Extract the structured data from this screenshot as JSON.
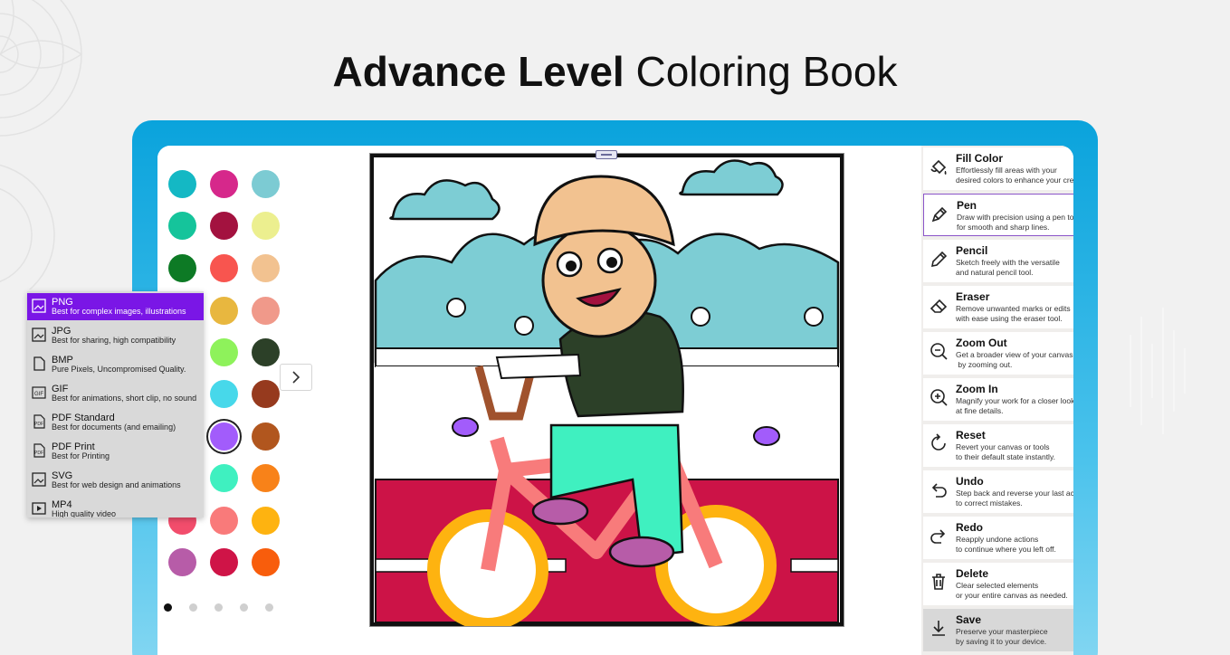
{
  "headline": {
    "bold": "Advance Level",
    "regular": "Coloring Book"
  },
  "palette": {
    "colors": [
      "#14b8c4",
      "#d6288b",
      "#7ccbd3",
      "#15c49b",
      "#a3123f",
      "#ecef8f",
      "#0d7a25",
      "#f8554f",
      "#f2c290",
      "#2e9fc8",
      "#e8b73f",
      "#f0998a",
      "#6fc63a",
      "#8ef25b",
      "#2c4028",
      "#1d6bb5",
      "#47d8ea",
      "#963a1e",
      "#b276d4",
      "#a25cfb",
      "#b1561e",
      "#ff4f88",
      "#3ff0c0",
      "#f88219",
      "#f24d6c",
      "#f97a7a",
      "#feb310",
      "#b75ca8",
      "#cf1447",
      "#f85d0c"
    ],
    "selected_color": "#a25cfb",
    "page_count": 5,
    "active_page": 1
  },
  "tools": [
    {
      "name": "Fill Color",
      "desc": "Effortlessly fill areas with your\ndesired colors to enhance your creations.",
      "icon": "fill-color-icon"
    },
    {
      "name": "Pen",
      "desc": "Draw with precision using a pen tool\nfor smooth and sharp lines.",
      "icon": "pen-icon",
      "active": true
    },
    {
      "name": "Pencil",
      "desc": "Sketch freely with the versatile\nand natural pencil tool.",
      "icon": "pencil-icon"
    },
    {
      "name": "Eraser",
      "desc": "Remove unwanted marks or edits\nwith ease using the eraser tool.",
      "icon": "eraser-icon"
    },
    {
      "name": "Zoom Out",
      "desc": "Get a broader view of your canvas\n by zooming out.",
      "icon": "zoom-out-icon"
    },
    {
      "name": "Zoom In",
      "desc": "Magnify your work for a closer look\nat fine details.",
      "icon": "zoom-in-icon"
    },
    {
      "name": "Reset",
      "desc": "Revert your canvas or tools\nto their default state instantly.",
      "icon": "reset-icon"
    },
    {
      "name": "Undo",
      "desc": "Step back and reverse your last action\nto correct mistakes.",
      "icon": "undo-icon"
    },
    {
      "name": "Redo",
      "desc": "Reapply undone actions\nto continue where you left off.",
      "icon": "redo-icon"
    },
    {
      "name": "Delete",
      "desc": "Clear selected elements\nor your entire canvas as needed.",
      "icon": "trash-icon"
    },
    {
      "name": "Save",
      "desc": "Preserve your masterpiece\nby saving it to your device.",
      "icon": "save-icon"
    }
  ],
  "export_formats": [
    {
      "name": "PNG",
      "desc": "Best for complex images, illustrations",
      "icon": "png-image-icon",
      "active": true
    },
    {
      "name": "JPG",
      "desc": "Best for sharing, high compatibility",
      "icon": "jpg-image-icon"
    },
    {
      "name": "BMP",
      "desc": "Pure Pixels, Uncompromised Quality.",
      "icon": "bmp-file-icon"
    },
    {
      "name": "GIF",
      "desc": "Best for animations, short clip, no sound",
      "icon": "gif-icon"
    },
    {
      "name": "PDF Standard",
      "desc": "Best for documents (and emailing)",
      "icon": "pdf-icon"
    },
    {
      "name": "PDF Print",
      "desc": "Best for Printing",
      "icon": "pdf-print-icon"
    },
    {
      "name": "SVG",
      "desc": "Best for web design and animations",
      "icon": "svg-image-icon"
    },
    {
      "name": "MP4",
      "desc": "High quality video",
      "icon": "video-icon"
    }
  ]
}
